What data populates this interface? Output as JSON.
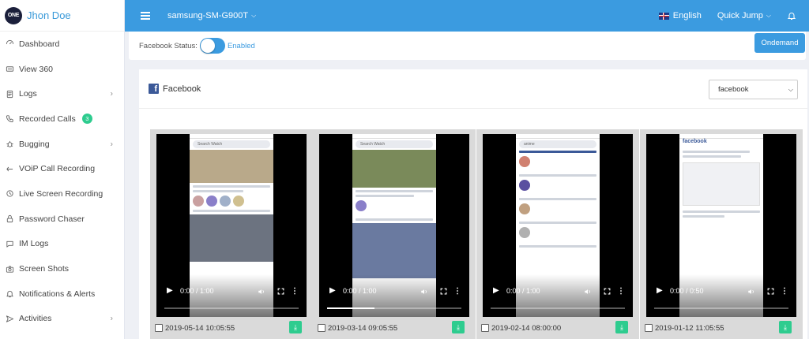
{
  "brand": {
    "logo_text": "ONE",
    "user_name": "Jhon Doe"
  },
  "topbar": {
    "device": "samsung-SM-G900T",
    "language": "English",
    "quick_jump": "Quick Jump"
  },
  "sidebar": {
    "items": [
      {
        "label": "Dashboard",
        "icon": "dashboard-icon",
        "has_submenu": false
      },
      {
        "label": "View 360",
        "icon": "view-360-icon",
        "has_submenu": false
      },
      {
        "label": "Logs",
        "icon": "logs-icon",
        "has_submenu": true
      },
      {
        "label": "Recorded Calls",
        "icon": "phone-icon",
        "has_submenu": false,
        "badge": "3"
      },
      {
        "label": "Bugging",
        "icon": "bug-icon",
        "has_submenu": true
      },
      {
        "label": "VOiP Call Recording",
        "icon": "voip-icon",
        "has_submenu": false
      },
      {
        "label": "Live Screen Recording",
        "icon": "screen-record-icon",
        "has_submenu": false
      },
      {
        "label": "Password Chaser",
        "icon": "lock-icon",
        "has_submenu": false
      },
      {
        "label": "IM Logs",
        "icon": "chat-icon",
        "has_submenu": false
      },
      {
        "label": "Screen Shots",
        "icon": "camera-icon",
        "has_submenu": false
      },
      {
        "label": "Notifications & Alerts",
        "icon": "bell-icon",
        "has_submenu": false
      },
      {
        "label": "Activities",
        "icon": "send-icon",
        "has_submenu": true
      }
    ]
  },
  "status": {
    "label": "Facebook Status:",
    "toggle_on": true,
    "toggle_text": "Enabled",
    "ondemand_label": "Ondemand"
  },
  "card": {
    "title": "Facebook",
    "app_select_value": "facebook"
  },
  "videos": [
    {
      "date": "2019-05-14 10:05:55",
      "time": "0:00 / 1:00",
      "progress": 0
    },
    {
      "date": "2019-03-14 09:05:55",
      "time": "0:00 / 1:00",
      "progress": 0.35
    },
    {
      "date": "2019-02-14 08:00:00",
      "time": "0:00 / 1:00",
      "progress": 0
    },
    {
      "date": "2019-01-12 11:05:55",
      "time": "0:00 / 0:50",
      "progress": 0
    }
  ],
  "colors": {
    "accent": "#3b9be0",
    "badge": "#2ecc8f",
    "facebook": "#3b5998"
  }
}
